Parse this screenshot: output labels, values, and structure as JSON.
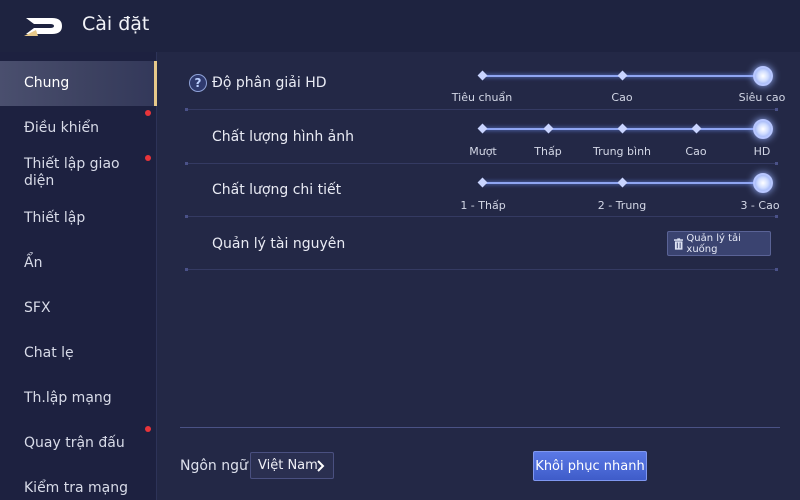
{
  "header": {
    "title": "Cài đặt",
    "back_icon": "back-arrow-icon"
  },
  "sidebar": {
    "items": [
      {
        "label": "Chung",
        "active": true,
        "badge": false
      },
      {
        "label": "Điều khiển",
        "active": false,
        "badge": true
      },
      {
        "label": "Thiết lập giao diện",
        "active": false,
        "badge": true
      },
      {
        "label": "Thiết lập",
        "active": false,
        "badge": false
      },
      {
        "label": "Ẩn",
        "active": false,
        "badge": false
      },
      {
        "label": "SFX",
        "active": false,
        "badge": false
      },
      {
        "label": "Chat lẹ",
        "active": false,
        "badge": false
      },
      {
        "label": "Th.lập mạng",
        "active": false,
        "badge": false
      },
      {
        "label": "Quay trận đấu",
        "active": false,
        "badge": true
      },
      {
        "label": "Kiểm tra mạng",
        "active": false,
        "badge": false
      }
    ]
  },
  "settings": {
    "resolution": {
      "label": "Độ phân giải HD",
      "help_icon": "?",
      "options": [
        "Tiêu chuẩn",
        "Cao",
        "Siêu cao"
      ],
      "selected_index": 2
    },
    "image_quality": {
      "label": "Chất lượng hình ảnh",
      "options": [
        "Mượt",
        "Thấp",
        "Trung bình",
        "Cao",
        "HD"
      ],
      "selected_index": 4
    },
    "detail_quality": {
      "label": "Chất lượng chi tiết",
      "options": [
        "1 - Thấp",
        "2 - Trung",
        "3 - Cao"
      ],
      "selected_index": 2
    },
    "resources": {
      "label": "Quản lý tài nguyên",
      "button_label": "Quản lý tải xuống",
      "button_icon": "trash-icon"
    }
  },
  "footer": {
    "language_label": "Ngôn ngữ",
    "language_value": "Việt Nam",
    "restore_label": "Khôi phục nhanh"
  },
  "colors": {
    "background": "#232846",
    "accent": "#e7c98a",
    "slider": "#8fa5f2",
    "badge": "#e8343a",
    "primary_button": "#4a68d6"
  }
}
